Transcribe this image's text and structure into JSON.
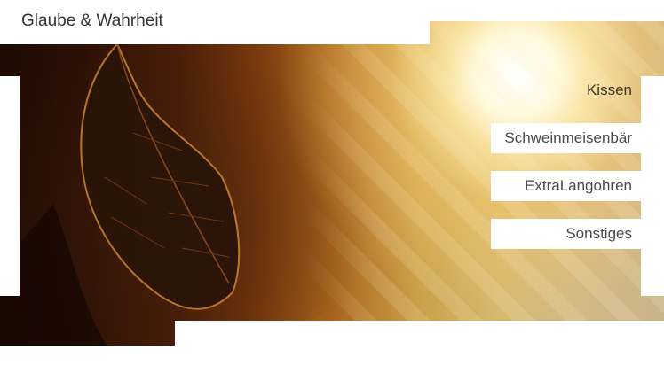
{
  "header": {
    "site_title": "Glaube & Wahrheit"
  },
  "nav": {
    "items": [
      {
        "label": "Kissen"
      },
      {
        "label": "Schweinmeisenbär"
      },
      {
        "label": "ExtraLangohren"
      },
      {
        "label": "Sonstiges"
      }
    ]
  },
  "colors": {
    "background": "#ffffff",
    "text": "#333333",
    "menu_text": "#4a4a4a",
    "hero_dark": "#1e0a04",
    "hero_warm": "#caa04a",
    "sun": "#fff9dc"
  },
  "hero": {
    "subject": "backlit leaf in front of setting sun"
  }
}
